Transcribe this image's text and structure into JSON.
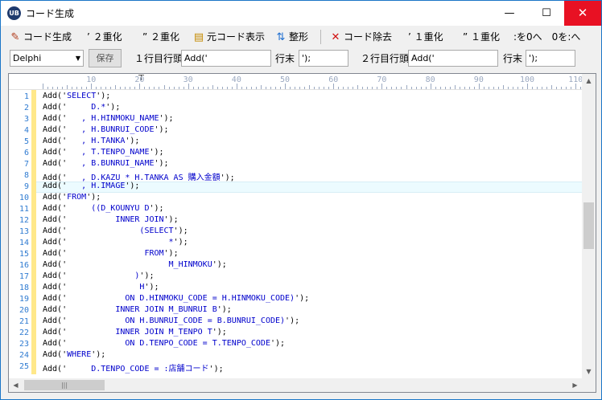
{
  "window": {
    "title": "コード生成",
    "icon_text": "UB",
    "minimize": "—",
    "maximize": "☐",
    "close": "✕"
  },
  "toolbar": {
    "generate_label": "コード生成",
    "single_quote_double_label": "’ ２重化",
    "double_quote_double_label": "” ２重化",
    "source_view_label": "元コード表示",
    "format_label": "整形",
    "remove_label": "コード除去",
    "single_quote_single_label": "’ １重化",
    "double_quote_single_label": "” １重化",
    "hint_label": ":を0へ　0を:へ"
  },
  "options": {
    "language": "Delphi",
    "save_label": "保存",
    "line1_head_label": "１行目行頭",
    "line1_head_value": "Add('",
    "line1_tail_label": "行末",
    "line1_tail_value": "');",
    "line2_head_label": "２行目行頭",
    "line2_head_value": "Add('",
    "line2_tail_label": "行末",
    "line2_tail_value": "');"
  },
  "ruler": [
    "10",
    "20",
    "30",
    "40",
    "50",
    "60",
    "70",
    "80",
    "90",
    "100",
    "110"
  ],
  "editor": {
    "current_line": 9,
    "lines": [
      {
        "n": "1",
        "pre": "Add('",
        "body": "SELECT",
        "post": "');"
      },
      {
        "n": "2",
        "pre": "Add('",
        "body": "     D.*",
        "post": "');"
      },
      {
        "n": "3",
        "pre": "Add('",
        "body": "   , H.HINMOKU_NAME",
        "post": "');"
      },
      {
        "n": "4",
        "pre": "Add('",
        "body": "   , H.BUNRUI_CODE",
        "post": "');"
      },
      {
        "n": "5",
        "pre": "Add('",
        "body": "   , H.TANKA",
        "post": "');"
      },
      {
        "n": "6",
        "pre": "Add('",
        "body": "   , T.TENPO_NAME",
        "post": "');"
      },
      {
        "n": "7",
        "pre": "Add('",
        "body": "   , B.BUNRUI_NAME",
        "post": "');"
      },
      {
        "n": "8",
        "pre": "Add('",
        "body": "   , D.KAZU * H.TANKA AS 購入金額",
        "post": "');"
      },
      {
        "n": "9",
        "pre": "Add('",
        "body": "   , H.IMAGE",
        "post": "');"
      },
      {
        "n": "10",
        "pre": "Add('",
        "body": "FROM",
        "post": "');"
      },
      {
        "n": "11",
        "pre": "Add('",
        "body": "     ((D_KOUNYU D",
        "post": "');"
      },
      {
        "n": "12",
        "pre": "Add('",
        "body": "          INNER JOIN",
        "post": "');"
      },
      {
        "n": "13",
        "pre": "Add('",
        "body": "               (SELECT",
        "post": "');"
      },
      {
        "n": "14",
        "pre": "Add('",
        "body": "                     *",
        "post": "');"
      },
      {
        "n": "15",
        "pre": "Add('",
        "body": "                FROM",
        "post": "');"
      },
      {
        "n": "16",
        "pre": "Add('",
        "body": "                     M_HINMOKU",
        "post": "');"
      },
      {
        "n": "17",
        "pre": "Add('",
        "body": "              )",
        "post": "');"
      },
      {
        "n": "18",
        "pre": "Add('",
        "body": "               H",
        "post": "');"
      },
      {
        "n": "19",
        "pre": "Add('",
        "body": "            ON D.HINMOKU_CODE = H.HINMOKU_CODE)",
        "post": "');"
      },
      {
        "n": "20",
        "pre": "Add('",
        "body": "          INNER JOIN M_BUNRUI B",
        "post": "');"
      },
      {
        "n": "21",
        "pre": "Add('",
        "body": "            ON H.BUNRUI_CODE = B.BUNRUI_CODE)",
        "post": "');"
      },
      {
        "n": "22",
        "pre": "Add('",
        "body": "          INNER JOIN M_TENPO T",
        "post": "');"
      },
      {
        "n": "23",
        "pre": "Add('",
        "body": "            ON D.TENPO_CODE = T.TENPO_CODE",
        "post": "');"
      },
      {
        "n": "24",
        "pre": "Add('",
        "body": "WHERE",
        "post": "');"
      },
      {
        "n": "25",
        "pre": "Add('",
        "body": "     D.TENPO_CODE = :店舗コード",
        "post": "');"
      }
    ]
  },
  "scrollbar": {
    "up": "▲",
    "down": "▼",
    "left": "◀",
    "right": "▶",
    "grip": "|||"
  }
}
